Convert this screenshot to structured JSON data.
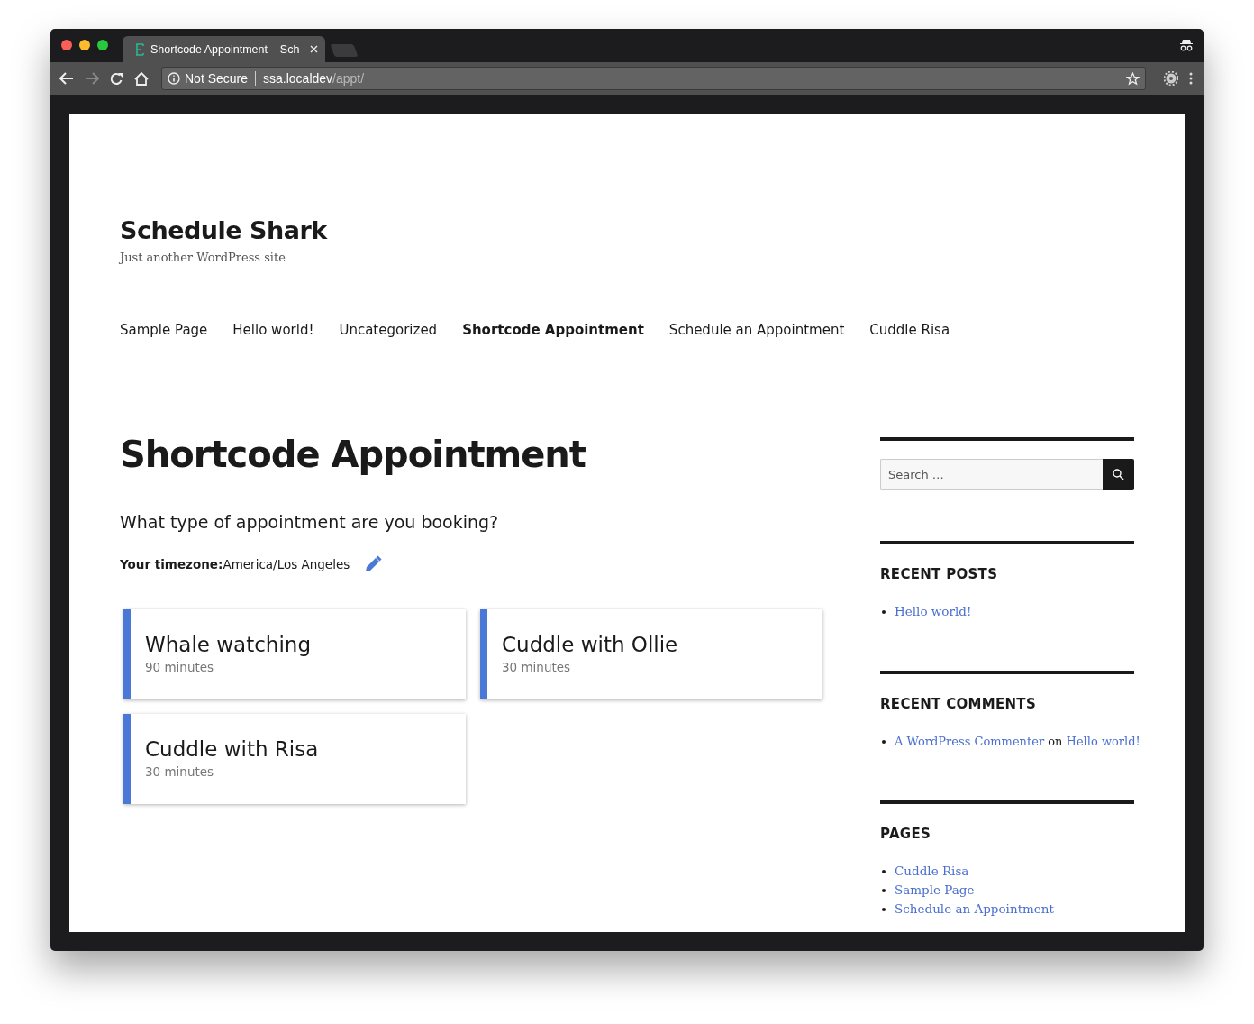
{
  "browser": {
    "tab_title": "Shortcode Appointment – Sch",
    "security": "Not Secure",
    "url_host": "ssa.localdev",
    "url_path": "/appt/"
  },
  "site": {
    "title": "Schedule Shark",
    "tagline": "Just another WordPress site"
  },
  "nav": [
    {
      "label": "Sample Page",
      "selected": false
    },
    {
      "label": "Hello world!",
      "selected": false
    },
    {
      "label": "Uncategorized",
      "selected": false
    },
    {
      "label": "Shortcode Appointment",
      "selected": true
    },
    {
      "label": "Schedule an Appointment",
      "selected": false
    },
    {
      "label": "Cuddle Risa",
      "selected": false
    }
  ],
  "page": {
    "title": "Shortcode Appointment",
    "question": "What type of appointment are you booking?",
    "timezone_label": "Your timezone:",
    "timezone": "America/Los Angeles"
  },
  "appointment_types": [
    {
      "name": "Whale watching",
      "duration": "90 minutes",
      "color": "#4a78d6"
    },
    {
      "name": "Cuddle with Ollie",
      "duration": "30 minutes",
      "color": "#4a78d6"
    },
    {
      "name": "Cuddle with Risa",
      "duration": "30 minutes",
      "color": "#4a78d6"
    }
  ],
  "sidebar": {
    "search": {
      "placeholder": "Search …"
    },
    "recent_posts": {
      "heading": "RECENT POSTS",
      "items": [
        "Hello world!"
      ]
    },
    "recent_comments": {
      "heading": "RECENT COMMENTS",
      "items": [
        {
          "author": "A WordPress Commenter",
          "connector": "on",
          "post": "Hello world!"
        }
      ]
    },
    "pages": {
      "heading": "PAGES",
      "items": [
        "Cuddle Risa",
        "Sample Page",
        "Schedule an Appointment"
      ]
    }
  }
}
